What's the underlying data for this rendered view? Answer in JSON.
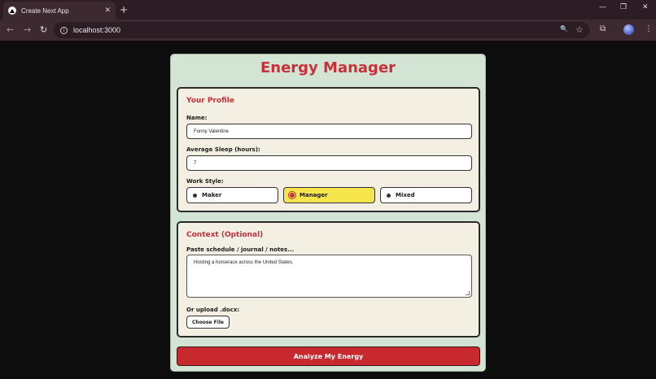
{
  "browser": {
    "tab_title": "Create Next App",
    "tab_close": "✕",
    "new_tab": "+",
    "url": "localhost:3000",
    "win_minimize": "—",
    "win_restore": "❐",
    "win_close": "✕",
    "back": "←",
    "forward": "→",
    "reload": "↻",
    "zoom_icon": "🔍",
    "star_icon": "☆",
    "cast_icon": "⧉",
    "menu": "⋮"
  },
  "app": {
    "title": "Energy Manager",
    "profile": {
      "heading": "Your Profile",
      "name_label": "Name:",
      "name_value": "Funny Valentine",
      "sleep_label": "Average Sleep (hours):",
      "sleep_value": "7",
      "work_style_label": "Work Style:",
      "work_styles": [
        "Maker",
        "Manager",
        "Mixed"
      ],
      "selected_style": "Manager"
    },
    "context": {
      "heading": "Context (Optional)",
      "notes_label": "Paste schedule / journal / notes...",
      "notes_value": "Hosting a horserace across the United States.",
      "upload_label": "Or upload .docx:",
      "choose_file": "Choose File"
    },
    "analyze_button": "Analyze My Energy"
  },
  "colors": {
    "accent_red": "#c8303a",
    "card_green": "#d4e4d4",
    "section_bg": "#f3f0e3",
    "selected_yellow": "#f6e54d"
  }
}
